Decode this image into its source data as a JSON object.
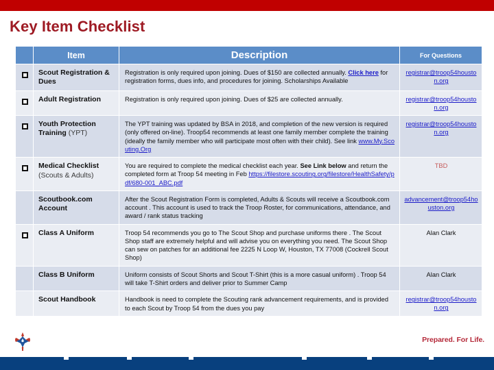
{
  "page": {
    "title": "Key Item Checklist",
    "accent_red": "#9E1B24",
    "top_bar_color": "#C00000",
    "bottom_bar_color": "#08407E",
    "header_blue": "#5B8DC8",
    "tagline": "Prepared. For Life.",
    "logo_alt": "bsa-fleur-de-lis-logo"
  },
  "table": {
    "headers": {
      "checkbox": "",
      "item": "Item",
      "description": "Description",
      "questions": "For Questions"
    },
    "rows": [
      {
        "checkbox": true,
        "item": "Scout Registration & Dues",
        "item_bold": "Scout Registration & Dues",
        "item_sub": "",
        "desc_parts": [
          {
            "type": "text",
            "text": "Registration is only required upon joining. Dues of $150 are collected annually. "
          },
          {
            "type": "link-bold",
            "text": "Click here"
          },
          {
            "type": "text",
            "text": " for registration forms, dues info, and procedures for joining. Scholarships Available"
          }
        ],
        "questions": {
          "type": "link",
          "text": "registrar@troop54houston.org"
        }
      },
      {
        "checkbox": true,
        "item_bold": "Adult Registration",
        "item_sub": "",
        "desc_parts": [
          {
            "type": "text",
            "text": "Registration is only required upon joining. Dues of $25 are collected annually."
          }
        ],
        "questions": {
          "type": "link",
          "text": "registrar@troop54houston.org"
        }
      },
      {
        "checkbox": true,
        "item_bold": "Youth Protection Training",
        "item_sub": " (YPT)",
        "desc_parts": [
          {
            "type": "text",
            "text": "The YPT training was updated by BSA in 2018, and completion of the new version is required (only offered on-line). Troop54 recommends at least one family member complete the training (ideally the family member who will participate most often with their child).  See link  "
          },
          {
            "type": "link",
            "text": "www.My.Scouting.Org"
          }
        ],
        "questions": {
          "type": "link",
          "text": "registrar@troop54houston.org"
        }
      },
      {
        "checkbox": true,
        "item_bold": "Medical Checklist",
        "item_sub": "(Scouts & Adults)",
        "desc_parts": [
          {
            "type": "text",
            "text": "You are required to complete the medical checklist each year. "
          },
          {
            "type": "bold",
            "text": "See Link below"
          },
          {
            "type": "text",
            "text": " and return the completed form at Troop 54 meeting in Feb "
          },
          {
            "type": "link",
            "text": "https://filestore.scouting.org/filestore/HealthSafety/pdf/680-001_ABC.pdf"
          }
        ],
        "questions": {
          "type": "tbd",
          "text": "TBD"
        }
      },
      {
        "checkbox": false,
        "item_bold": "Scoutbook.com Account",
        "item_sub": "",
        "desc_parts": [
          {
            "type": "text",
            "text": "After the Scout Registration Form is completed, Adults & Scouts will receive a Scoutbook.com account . This account is used to track the Troop Roster, for communications, attendance, and award / rank status tracking"
          }
        ],
        "questions": {
          "type": "link",
          "text": "advancement@troop54houston.org"
        }
      },
      {
        "checkbox": true,
        "item_bold": "Class A Uniform",
        "item_sub": "",
        "desc_parts": [
          {
            "type": "text",
            "text": "Troop 54 recommends you go to The Scout Shop and purchase uniforms there . The Scout Shop staff are extremely helpful and will advise you on everything you need. The Scout Shop can sew on patches for an additional fee 2225 N Loop W, Houston, TX 77008 (Cockrell Scout Shop)"
          }
        ],
        "questions": {
          "type": "name",
          "text": "Alan Clark"
        }
      },
      {
        "checkbox": false,
        "item_bold": "Class B Uniform",
        "item_sub": "",
        "desc_parts": [
          {
            "type": "text",
            "text": "Uniform consists of Scout Shorts and Scout T-Shirt (this is a more casual uniform) . Troop 54 will take T-Shirt orders and deliver prior to Summer Camp"
          }
        ],
        "questions": {
          "type": "name",
          "text": "Alan Clark"
        }
      },
      {
        "checkbox": false,
        "item_bold": "Scout Handbook",
        "item_sub": "",
        "desc_parts": [
          {
            "type": "text",
            "text": "Handbook is need to complete the Scouting rank advancement requirements, and is provided to each Scout by Troop 54 from the dues you pay"
          }
        ],
        "questions": {
          "type": "link",
          "text": "registrar@troop54houston.org"
        }
      }
    ]
  }
}
